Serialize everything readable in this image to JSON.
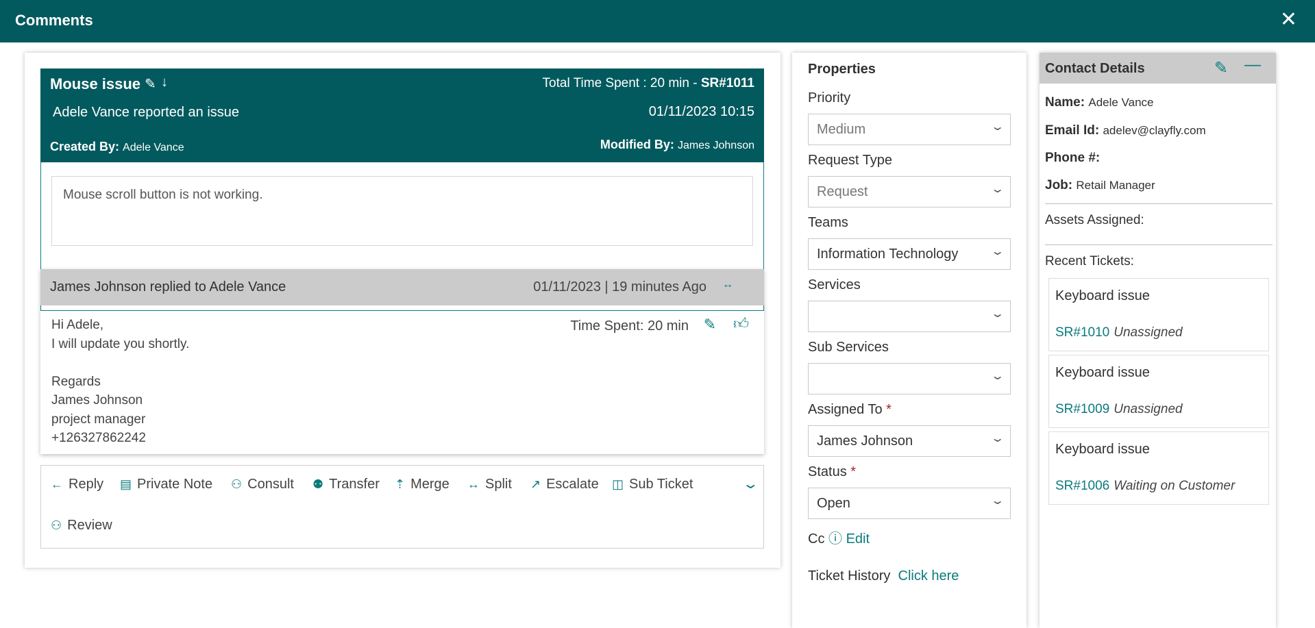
{
  "window": {
    "title": "Comments",
    "close_icon": "close-icon"
  },
  "ticket": {
    "title": "Mouse issue",
    "total_time": "Total Time Spent : 20 min - ",
    "id": "SR#1011",
    "reported": "Adele Vance reported an issue",
    "datetime": "01/11/2023 10:15",
    "created_by_label": "Created By:",
    "created_by": "Adele Vance",
    "modified_by_label": "Modified By:",
    "modified_by": "James Johnson",
    "description": "Mouse scroll button is not working."
  },
  "reply": {
    "header": "James Johnson replied to Adele Vance",
    "meta": "01/11/2023 | 19 minutes Ago",
    "time_spent": "Time Spent: 20 min",
    "lines": [
      "Hi Adele,",
      "I will update you shortly.",
      "",
      "Regards",
      "James Johnson",
      "project manager",
      "+126327862242"
    ]
  },
  "actions": [
    {
      "label": "Reply",
      "icon": "arrow-left-icon"
    },
    {
      "label": "Private Note",
      "icon": "note-icon"
    },
    {
      "label": "Consult",
      "icon": "consult-icon"
    },
    {
      "label": "Transfer",
      "icon": "transfer-icon"
    },
    {
      "label": "Merge",
      "icon": "merge-icon"
    },
    {
      "label": "Split",
      "icon": "split-icon"
    },
    {
      "label": "Escalate",
      "icon": "escalate-icon"
    },
    {
      "label": "Sub Ticket",
      "icon": "sub-ticket-icon"
    },
    {
      "label": "Review",
      "icon": "review-icon"
    }
  ],
  "properties": {
    "title": "Properties",
    "fields": [
      {
        "label": "Priority",
        "value": "Medium"
      },
      {
        "label": "Request Type",
        "value": "Request"
      },
      {
        "label": "Teams",
        "value": "Information Technology"
      },
      {
        "label": "Services",
        "value": ""
      },
      {
        "label": "Sub Services",
        "value": ""
      },
      {
        "label": "Assigned To",
        "value": "James Johnson",
        "required": "*"
      },
      {
        "label": "Status",
        "value": "Open",
        "required": "*"
      }
    ],
    "cc_label": "Cc",
    "cc_edit": "Edit",
    "history_label": "Ticket History",
    "history_link": "Click here"
  },
  "contact": {
    "title": "Contact Details",
    "name_label": "Name:",
    "name": "Adele Vance",
    "email_label": "Email Id:",
    "email": "adelev@clayfly.com",
    "phone_label": "Phone #:",
    "job_label": "Job:",
    "job": "Retail Manager",
    "assets_label": "Assets Assigned:",
    "recent_label": "Recent Tickets:",
    "tickets": [
      {
        "title": "Keyboard issue",
        "id": "SR#1010",
        "status": "Unassigned"
      },
      {
        "title": "Keyboard issue",
        "id": "SR#1009",
        "status": "Unassigned"
      },
      {
        "title": "Keyboard issue",
        "id": "SR#1006",
        "status": "Waiting on Customer"
      }
    ]
  },
  "colors": {
    "brand": "#035a5e",
    "accent": "#0b7a7e",
    "header_gray": "#cbcbcb",
    "required": "#a4262c"
  }
}
